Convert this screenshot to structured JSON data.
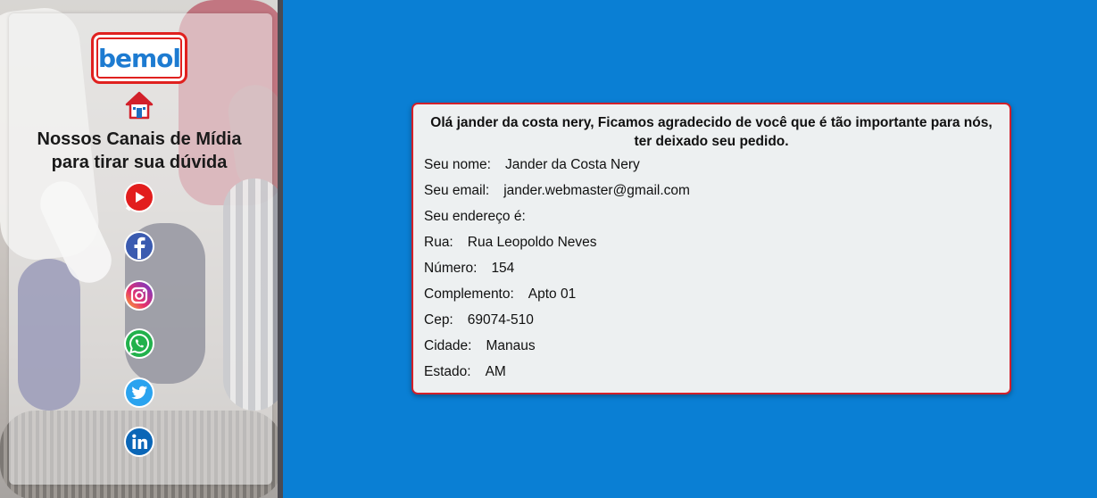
{
  "sidebar": {
    "logo_text": "bemol",
    "channels_title_line1": "Nossos Canais de Mídia",
    "channels_title_line2": "para tirar sua dúvida",
    "social_icons": [
      "youtube-icon",
      "facebook-icon",
      "instagram-icon",
      "whatsapp-icon",
      "twitter-icon",
      "linkedin-icon"
    ]
  },
  "colors": {
    "background": "#0a7fd4",
    "card_border": "#d2202a",
    "card_background": "#edf0f1",
    "logo_red": "#e0211f",
    "logo_blue": "#1d7bd1"
  },
  "card": {
    "greeting_line1": "Olá jander da costa nery, Ficamos agradecido de você que é tão importante para nós,",
    "greeting_line2": "ter deixado seu pedido.",
    "fields": {
      "name_label": "Seu nome:",
      "name_value": "Jander da Costa Nery",
      "email_label": "Seu email:",
      "email_value": "jander.webmaster@gmail.com",
      "address_label": "Seu endereço é:",
      "street_label": "Rua:",
      "street_value": "Rua Leopoldo Neves",
      "number_label": "Número:",
      "number_value": "154",
      "complement_label": "Complemento:",
      "complement_value": "Apto 01",
      "cep_label": "Cep:",
      "cep_value": "69074-510",
      "city_label": "Cidade:",
      "city_value": "Manaus",
      "state_label": "Estado:",
      "state_value": "AM"
    }
  }
}
